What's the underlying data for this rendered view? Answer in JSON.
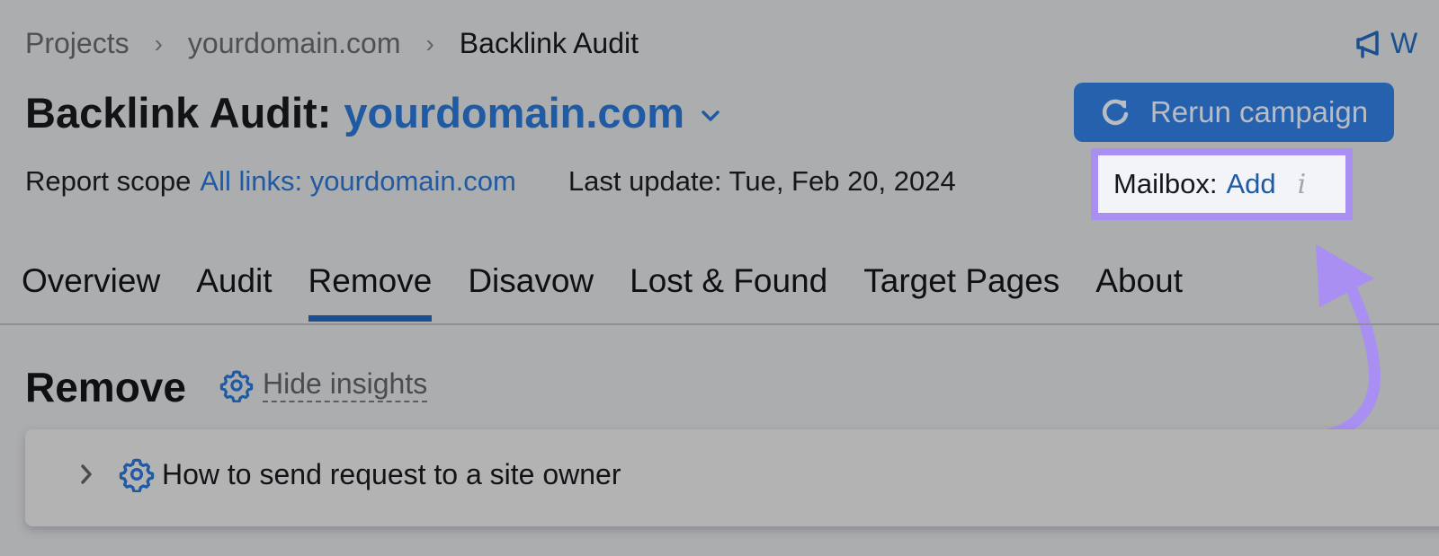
{
  "breadcrumb": {
    "items": [
      "Projects",
      "yourdomain.com",
      "Backlink Audit"
    ],
    "separator": "›"
  },
  "header": {
    "title_prefix": "Backlink Audit:",
    "domain": "yourdomain.com",
    "feedback_label_partial": "W",
    "rerun_label": "Rerun campaign"
  },
  "meta": {
    "report_scope_label": "Report scope",
    "report_scope_value": "All links: yourdomain.com",
    "last_update": "Last update: Tue, Feb 20, 2024",
    "mailbox_label": "Mailbox:",
    "mailbox_action": "Add",
    "info_glyph": "i"
  },
  "tabs": [
    {
      "label": "Overview",
      "active": false
    },
    {
      "label": "Audit",
      "active": false
    },
    {
      "label": "Remove",
      "active": true
    },
    {
      "label": "Disavow",
      "active": false
    },
    {
      "label": "Lost & Found",
      "active": false
    },
    {
      "label": "Target Pages",
      "active": false
    },
    {
      "label": "About",
      "active": false
    }
  ],
  "section": {
    "title": "Remove",
    "hide_insights_label": "Hide insights"
  },
  "insight_card": {
    "label": "How to send request to a site owner"
  },
  "colors": {
    "accent": "#2561ad",
    "link": "#1f5aa3",
    "highlight": "#aa8ff2",
    "background": "#acadaf"
  },
  "icons": {
    "feedback": "megaphone-icon",
    "rerun": "refresh-icon",
    "domain_dropdown": "chevron-down-icon",
    "info": "info-icon",
    "settings": "gear-icon",
    "expand": "chevron-right-icon"
  }
}
